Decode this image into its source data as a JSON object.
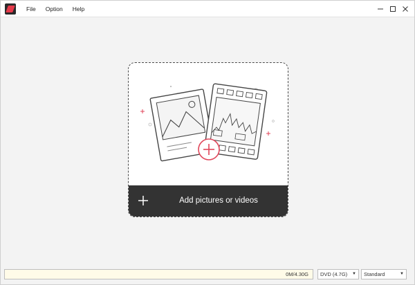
{
  "menu": {
    "items": [
      "File",
      "Option",
      "Help"
    ]
  },
  "window_controls": {
    "minimize_icon": "minimize-icon",
    "maximize_icon": "maximize-icon",
    "close_icon": "close-icon"
  },
  "dropzone": {
    "add_label": "Add pictures or videos",
    "accent_color": "#e0465a",
    "bar_color": "#333333"
  },
  "status": {
    "capacity_text": "0M/4.30G",
    "capacity_fraction": 0,
    "disc_type": "DVD (4.7G)",
    "quality": "Standard"
  }
}
